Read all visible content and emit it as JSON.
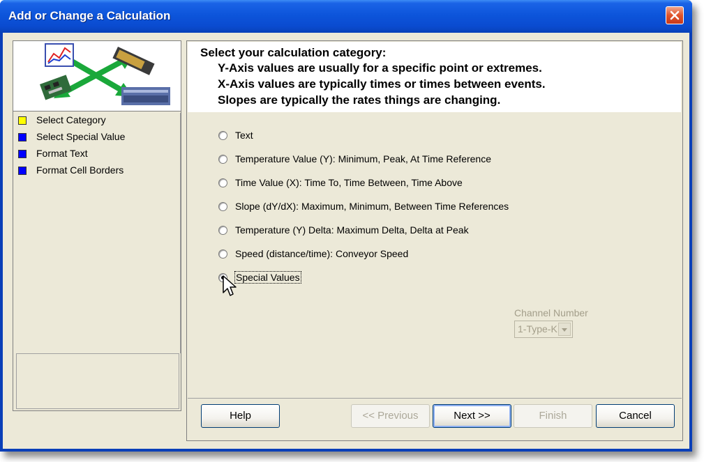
{
  "window": {
    "title": "Add or Change a Calculation"
  },
  "sidebar": {
    "steps": [
      {
        "label": "Select Category",
        "color": "#ffff00"
      },
      {
        "label": "Select Special Value",
        "color": "#0000ff"
      },
      {
        "label": "Format Text",
        "color": "#0000ff"
      },
      {
        "label": "Format Cell Borders",
        "color": "#0000ff"
      }
    ]
  },
  "header": {
    "title": "Select your calculation category:",
    "line1": "Y-Axis values are usually for a specific point or extremes.",
    "line2": "X-Axis values are typically times or times between events.",
    "line3": "Slopes are typically the rates things are changing."
  },
  "options": [
    {
      "label": "Text",
      "selected": false
    },
    {
      "label": "Temperature Value (Y):  Minimum, Peak, At Time Reference",
      "selected": false
    },
    {
      "label": "Time Value (X):  Time To, Time Between, Time Above",
      "selected": false
    },
    {
      "label": "Slope (dY/dX):  Maximum, Minimum, Between Time References",
      "selected": false
    },
    {
      "label": "Temperature (Y) Delta:  Maximum Delta, Delta at Peak",
      "selected": false
    },
    {
      "label": "Speed (distance/time): Conveyor Speed",
      "selected": false
    },
    {
      "label": "Special  Values",
      "selected": true
    }
  ],
  "channel": {
    "label": "Channel Number",
    "value": "1-Type-K"
  },
  "buttons": {
    "help": "Help",
    "previous": "<< Previous",
    "next": "Next >>",
    "finish": "Finish",
    "cancel": "Cancel"
  }
}
